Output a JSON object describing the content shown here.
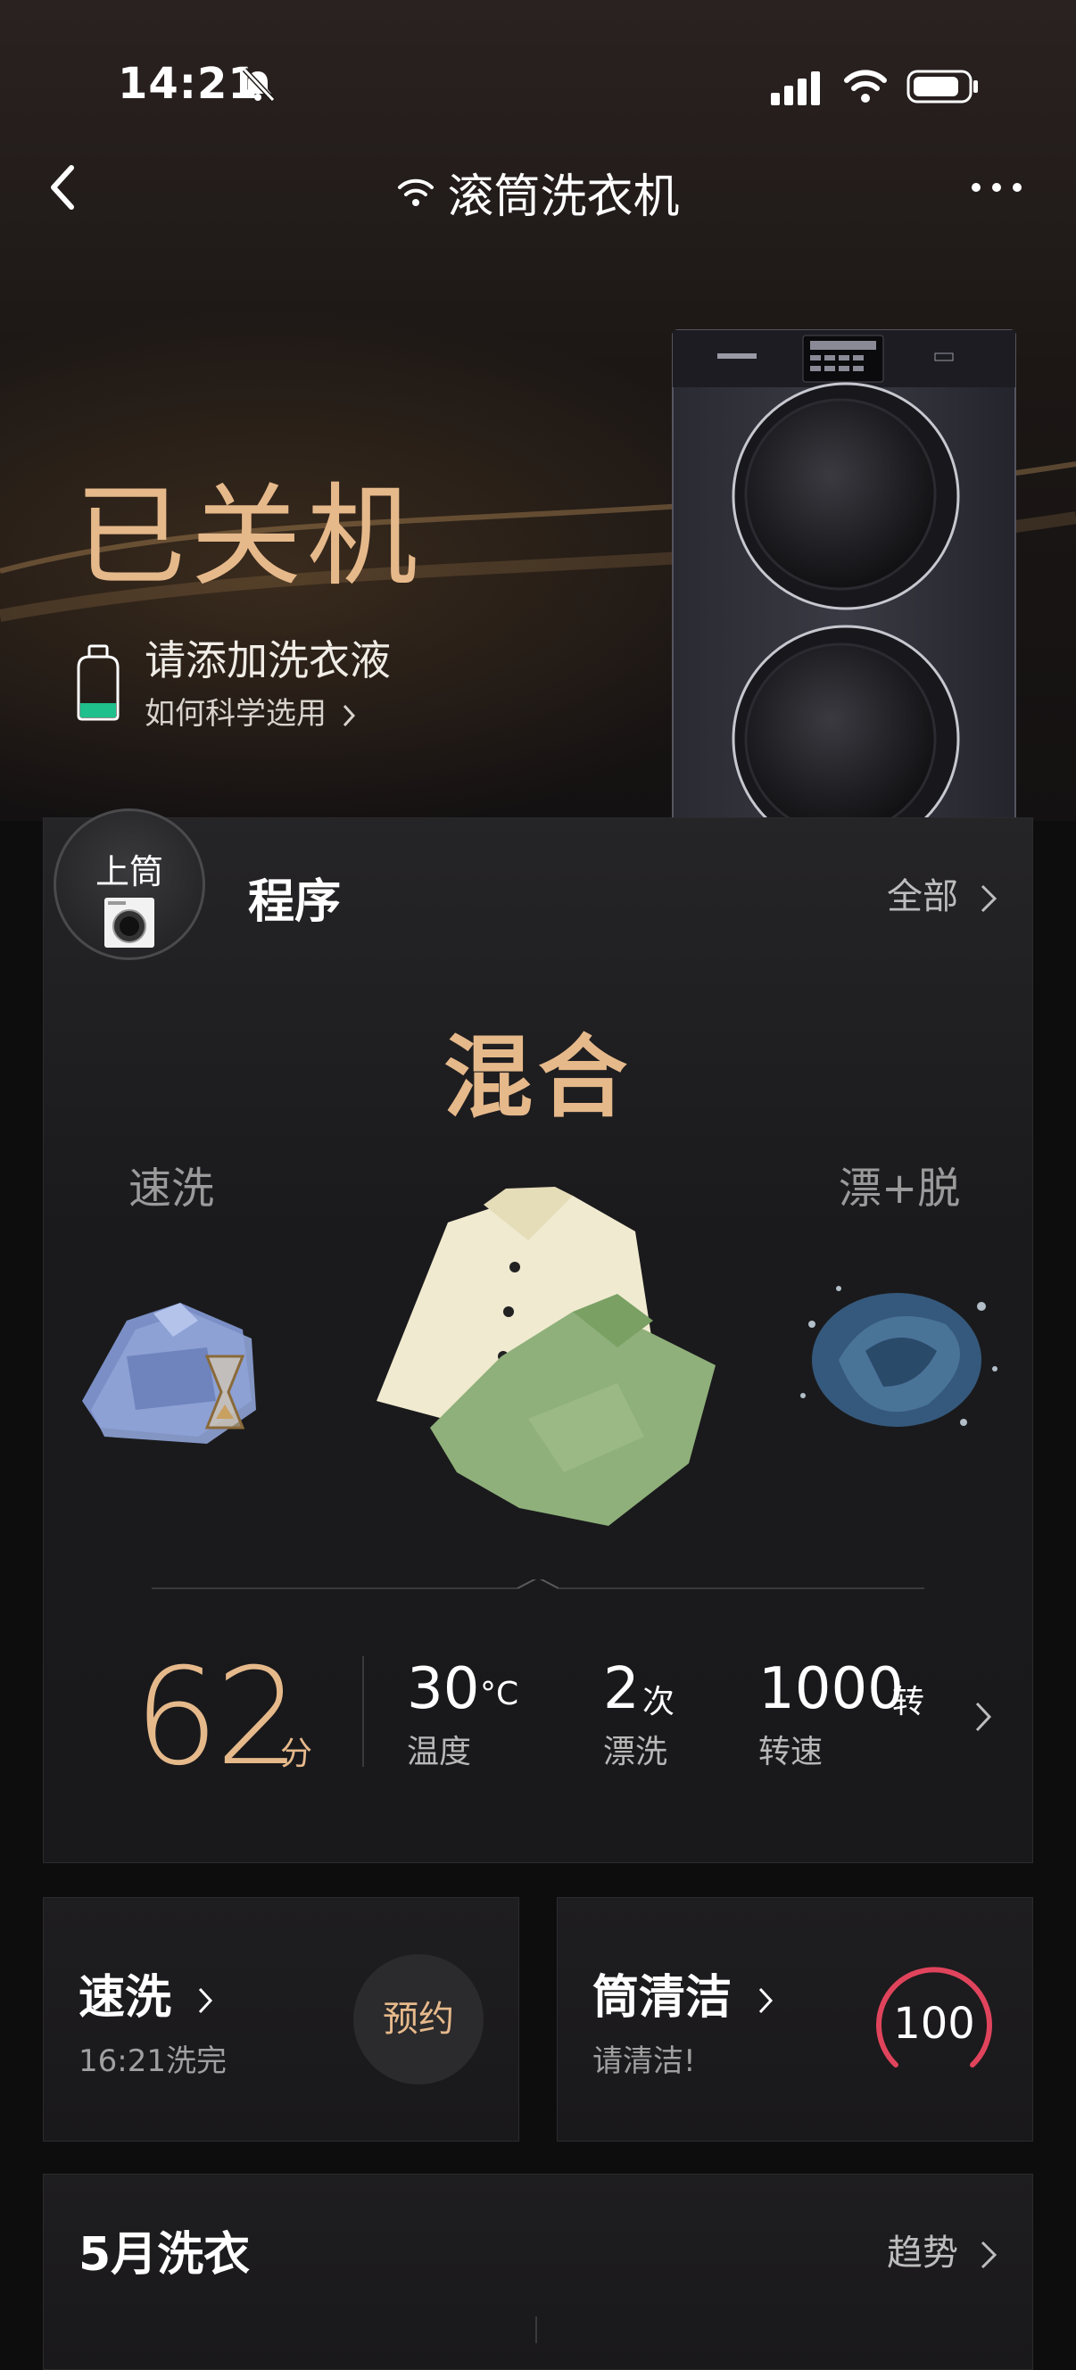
{
  "status_bar": {
    "time": "14:21"
  },
  "nav": {
    "title": "滚筒洗衣机"
  },
  "device": {
    "power_status": "已关机",
    "tip_title": "请添加洗衣液",
    "tip_link": "如何科学选用"
  },
  "program": {
    "drum": "上筒",
    "label": "程序",
    "all_link": "全部",
    "current_mode": "混合",
    "prev_mode": "速洗",
    "next_mode": "漂+脱",
    "duration_value": "62",
    "duration_unit": "分",
    "params": [
      {
        "value": "30",
        "unit": "°C",
        "label": "温度"
      },
      {
        "value": "2",
        "unit": "次",
        "label": "漂洗"
      },
      {
        "value": "1000",
        "unit": "转",
        "label": "转速"
      }
    ]
  },
  "quick_wash": {
    "title": "速洗",
    "subtitle": "16:21洗完",
    "button": "预约"
  },
  "drum_clean": {
    "title": "筒清洁",
    "subtitle": "请清洁!",
    "value": "100"
  },
  "monthly": {
    "title": "5月洗衣",
    "trend_link": "趋势"
  },
  "colors": {
    "accent_gold": "#e6b98b",
    "ring_red": "#e0445c",
    "card_bg": "#1c1b1d"
  }
}
